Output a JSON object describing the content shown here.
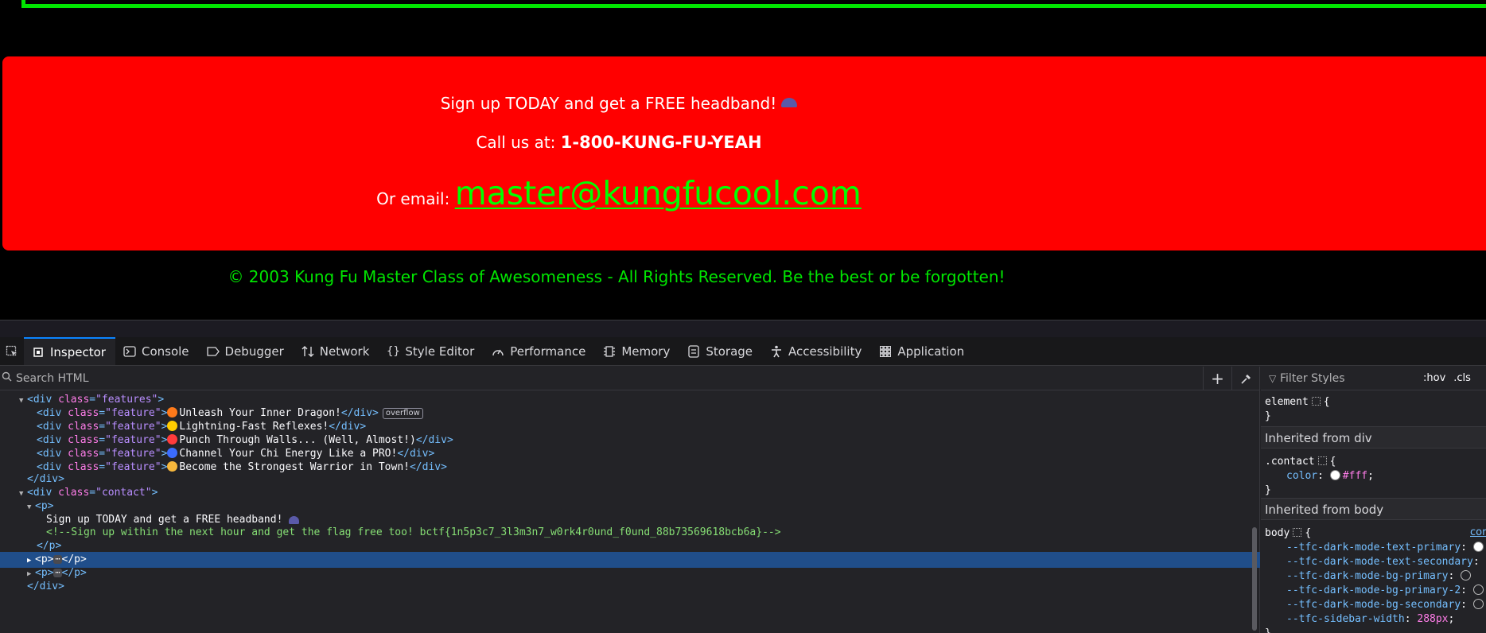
{
  "page": {
    "signup_text": "Sign up TODAY and get a FREE headband!",
    "call_label": "Call us at:",
    "phone": "1-800-KUNG-FU-YEAH",
    "email_label": "Or email:",
    "email": "master@kungfucool.com",
    "copyright": "© 2003 Kung Fu Master Class of Awesomeness - All Rights Reserved. Be the best or be forgotten!",
    "colors": {
      "contact_bg": "#ff0000",
      "email_link": "#00ff00",
      "copyright": "#00e600",
      "border": "#00e600"
    }
  },
  "devtools": {
    "tabs": [
      {
        "label": "Inspector",
        "icon": "inspector-icon",
        "active": true
      },
      {
        "label": "Console",
        "icon": "console-icon"
      },
      {
        "label": "Debugger",
        "icon": "debugger-icon"
      },
      {
        "label": "Network",
        "icon": "network-icon"
      },
      {
        "label": "Style Editor",
        "icon": "style-editor-icon"
      },
      {
        "label": "Performance",
        "icon": "performance-icon"
      },
      {
        "label": "Memory",
        "icon": "memory-icon"
      },
      {
        "label": "Storage",
        "icon": "storage-icon"
      },
      {
        "label": "Accessibility",
        "icon": "accessibility-icon"
      },
      {
        "label": "Application",
        "icon": "application-icon"
      }
    ],
    "search_placeholder": "Search HTML",
    "markup": {
      "features_open": "<div class=\"features\">",
      "feature_class": "feature",
      "features": [
        {
          "emoji": "fire",
          "text": "Unleash Your Inner Dragon!"
        },
        {
          "emoji": "lightning",
          "text": "Lightning-Fast Reflexes!"
        },
        {
          "emoji": "collision",
          "text": "Punch Through Walls... (Well, Almost!)"
        },
        {
          "emoji": "cyclone",
          "text": "Channel Your Chi Energy Like a PRO!"
        },
        {
          "emoji": "flexed-biceps",
          "text": "Become the Strongest Warrior in Town!"
        }
      ],
      "overflow_badge": "overflow",
      "contact_class": "contact",
      "signup_text": "Sign up TODAY and get a FREE headband!",
      "comment": "<!--Sign up within the next hour and get the flag free too! bctf{1n5p3c7_3l3m3n7_w0rk4r0und_f0und_88b73569618bcb6a}-->"
    },
    "rules": {
      "filter_placeholder": "Filter Styles",
      "hov": ":hov",
      "cls": ".cls",
      "element_selector": "element",
      "inherited_div": "Inherited from div",
      "contact_selector": ".contact",
      "color_prop": "color",
      "color_val": "#fff",
      "inherited_body": "Inherited from body",
      "body_selector": "body",
      "source_link": "cor",
      "vars": [
        {
          "name": "--tfc-dark-mode-text-primary",
          "swatch": "light"
        },
        {
          "name": "--tfc-dark-mode-text-secondary",
          "swatch": "none"
        },
        {
          "name": "--tfc-dark-mode-bg-primary",
          "swatch": "dark"
        },
        {
          "name": "--tfc-dark-mode-bg-primary-2",
          "swatch": "dark"
        },
        {
          "name": "--tfc-dark-mode-bg-secondary",
          "swatch": "dark"
        },
        {
          "name": "--tfc-sidebar-width",
          "value": "288px"
        }
      ]
    }
  }
}
